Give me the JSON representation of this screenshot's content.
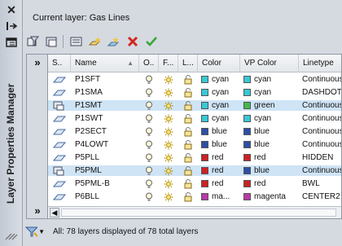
{
  "palette": {
    "title": "Layer Properties Manager"
  },
  "current_layer": "Current layer: Gas Lines",
  "columns": [
    {
      "key": "status",
      "label": "S.."
    },
    {
      "key": "name",
      "label": "Name"
    },
    {
      "key": "on",
      "label": "O.."
    },
    {
      "key": "freeze",
      "label": "F..."
    },
    {
      "key": "lock",
      "label": "L..."
    },
    {
      "key": "color",
      "label": "Color"
    },
    {
      "key": "vpcolor",
      "label": "VP Color"
    },
    {
      "key": "linetype",
      "label": "Linetype"
    }
  ],
  "layers": [
    {
      "name": "P1SFT",
      "color": "cyan",
      "color_hex": "#37c9d6",
      "vp": "cyan",
      "vp_hex": "#37c9d6",
      "linetype": "Continuous",
      "selected": false,
      "status_icon": "layer-icon"
    },
    {
      "name": "P1SMA",
      "color": "cyan",
      "color_hex": "#37c9d6",
      "vp": "cyan",
      "vp_hex": "#37c9d6",
      "linetype": "DASHDOT",
      "selected": false,
      "status_icon": "layer-icon"
    },
    {
      "name": "P1SMT",
      "color": "cyan",
      "color_hex": "#37c9d6",
      "vp": "green",
      "vp_hex": "#46b84a",
      "linetype": "Continuous",
      "selected": true,
      "status_icon": "layer-override-icon"
    },
    {
      "name": "P1SWT",
      "color": "cyan",
      "color_hex": "#37c9d6",
      "vp": "cyan",
      "vp_hex": "#37c9d6",
      "linetype": "Continuous",
      "selected": false,
      "status_icon": "layer-icon"
    },
    {
      "name": "P2SECT",
      "color": "blue",
      "color_hex": "#2d4fa6",
      "vp": "blue",
      "vp_hex": "#2d4fa6",
      "linetype": "Continuous",
      "selected": false,
      "status_icon": "layer-icon"
    },
    {
      "name": "P4LOWT",
      "color": "blue",
      "color_hex": "#2d4fa6",
      "vp": "blue",
      "vp_hex": "#2d4fa6",
      "linetype": "Continuous",
      "selected": false,
      "status_icon": "layer-icon"
    },
    {
      "name": "P5PLL",
      "color": "red",
      "color_hex": "#cc2222",
      "vp": "red",
      "vp_hex": "#cc2222",
      "linetype": "HIDDEN",
      "selected": false,
      "status_icon": "layer-icon"
    },
    {
      "name": "P5PML",
      "color": "red",
      "color_hex": "#cc2222",
      "vp": "blue",
      "vp_hex": "#2d4fa6",
      "linetype": "Continuous",
      "selected": true,
      "status_icon": "layer-override-icon"
    },
    {
      "name": "P5PML-B",
      "color": "red",
      "color_hex": "#cc2222",
      "vp": "red",
      "vp_hex": "#cc2222",
      "linetype": "BWL",
      "selected": false,
      "status_icon": "layer-icon"
    },
    {
      "name": "P6BLL",
      "color": "ma...",
      "color_hex": "#b83aa6",
      "vp": "magenta",
      "vp_hex": "#b83aa6",
      "linetype": "CENTER2",
      "selected": false,
      "status_icon": "layer-icon"
    }
  ],
  "status_text": "All: 78 layers displayed of 78 total layers"
}
